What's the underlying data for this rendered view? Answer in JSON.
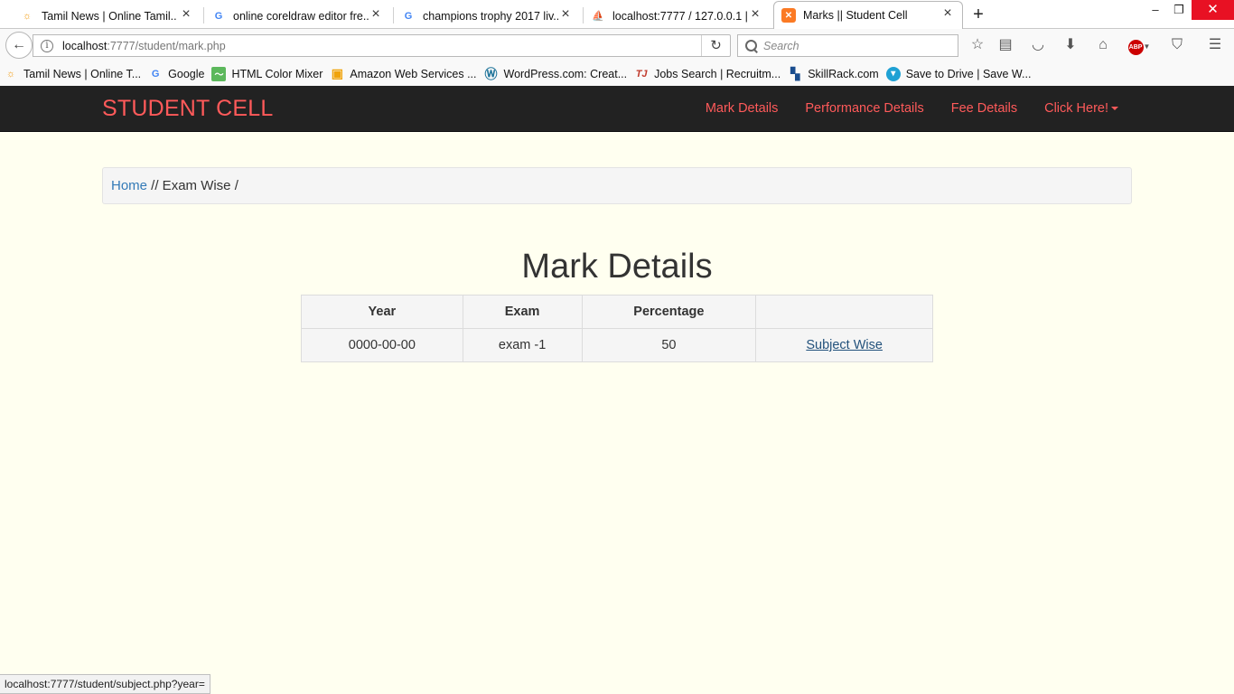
{
  "browser": {
    "tabs": [
      {
        "title": "Tamil News | Online Tamil...",
        "icon": "sun-icon",
        "color": "#f39c12"
      },
      {
        "title": "online coreldraw editor fre...",
        "icon": "google-icon",
        "color": "#4285f4"
      },
      {
        "title": "champions trophy 2017 liv...",
        "icon": "google-icon",
        "color": "#4285f4"
      },
      {
        "title": "localhost:7777 / 127.0.0.1 |...",
        "icon": "phpmyadmin-icon",
        "color": "#f7931e"
      },
      {
        "title": "Marks || Student Cell",
        "icon": "xampp-icon",
        "color": "#fb7a24"
      }
    ],
    "url_host": "localhost",
    "url_path": ":7777/student/mark.php",
    "search_placeholder": "Search",
    "bookmarks": [
      {
        "label": "Tamil News | Online T...",
        "icon": "sun-icon"
      },
      {
        "label": "Google",
        "icon": "google-icon"
      },
      {
        "label": "HTML Color Mixer",
        "icon": "chart-icon"
      },
      {
        "label": "Amazon Web Services ...",
        "icon": "box-icon"
      },
      {
        "label": "WordPress.com: Creat...",
        "icon": "wordpress-icon"
      },
      {
        "label": "Jobs Search | Recruitm...",
        "icon": "tj-icon"
      },
      {
        "label": "SkillRack.com",
        "icon": "skillrack-icon"
      },
      {
        "label": "Save to Drive | Save W...",
        "icon": "drive-icon"
      }
    ],
    "status_text": "localhost:7777/student/subject.php?year="
  },
  "site": {
    "brand": "STUDENT CELL",
    "nav": {
      "mark_details": "Mark Details",
      "performance_details": "Performance Details",
      "fee_details": "Fee Details",
      "click_here": "Click Here!"
    },
    "breadcrumb": {
      "home": "Home",
      "rest": " // Exam Wise /"
    },
    "page_title": "Mark Details",
    "table": {
      "headers": [
        "Year",
        "Exam",
        "Percentage",
        ""
      ],
      "rows": [
        {
          "year": "0000-00-00",
          "exam": "exam -1",
          "percentage": "50",
          "link": "Subject Wise"
        }
      ]
    }
  },
  "colors": {
    "brand": "#ff5a5a",
    "nav_bg": "#222222",
    "page_bg": "#fffff0",
    "link": "#337ab7"
  }
}
